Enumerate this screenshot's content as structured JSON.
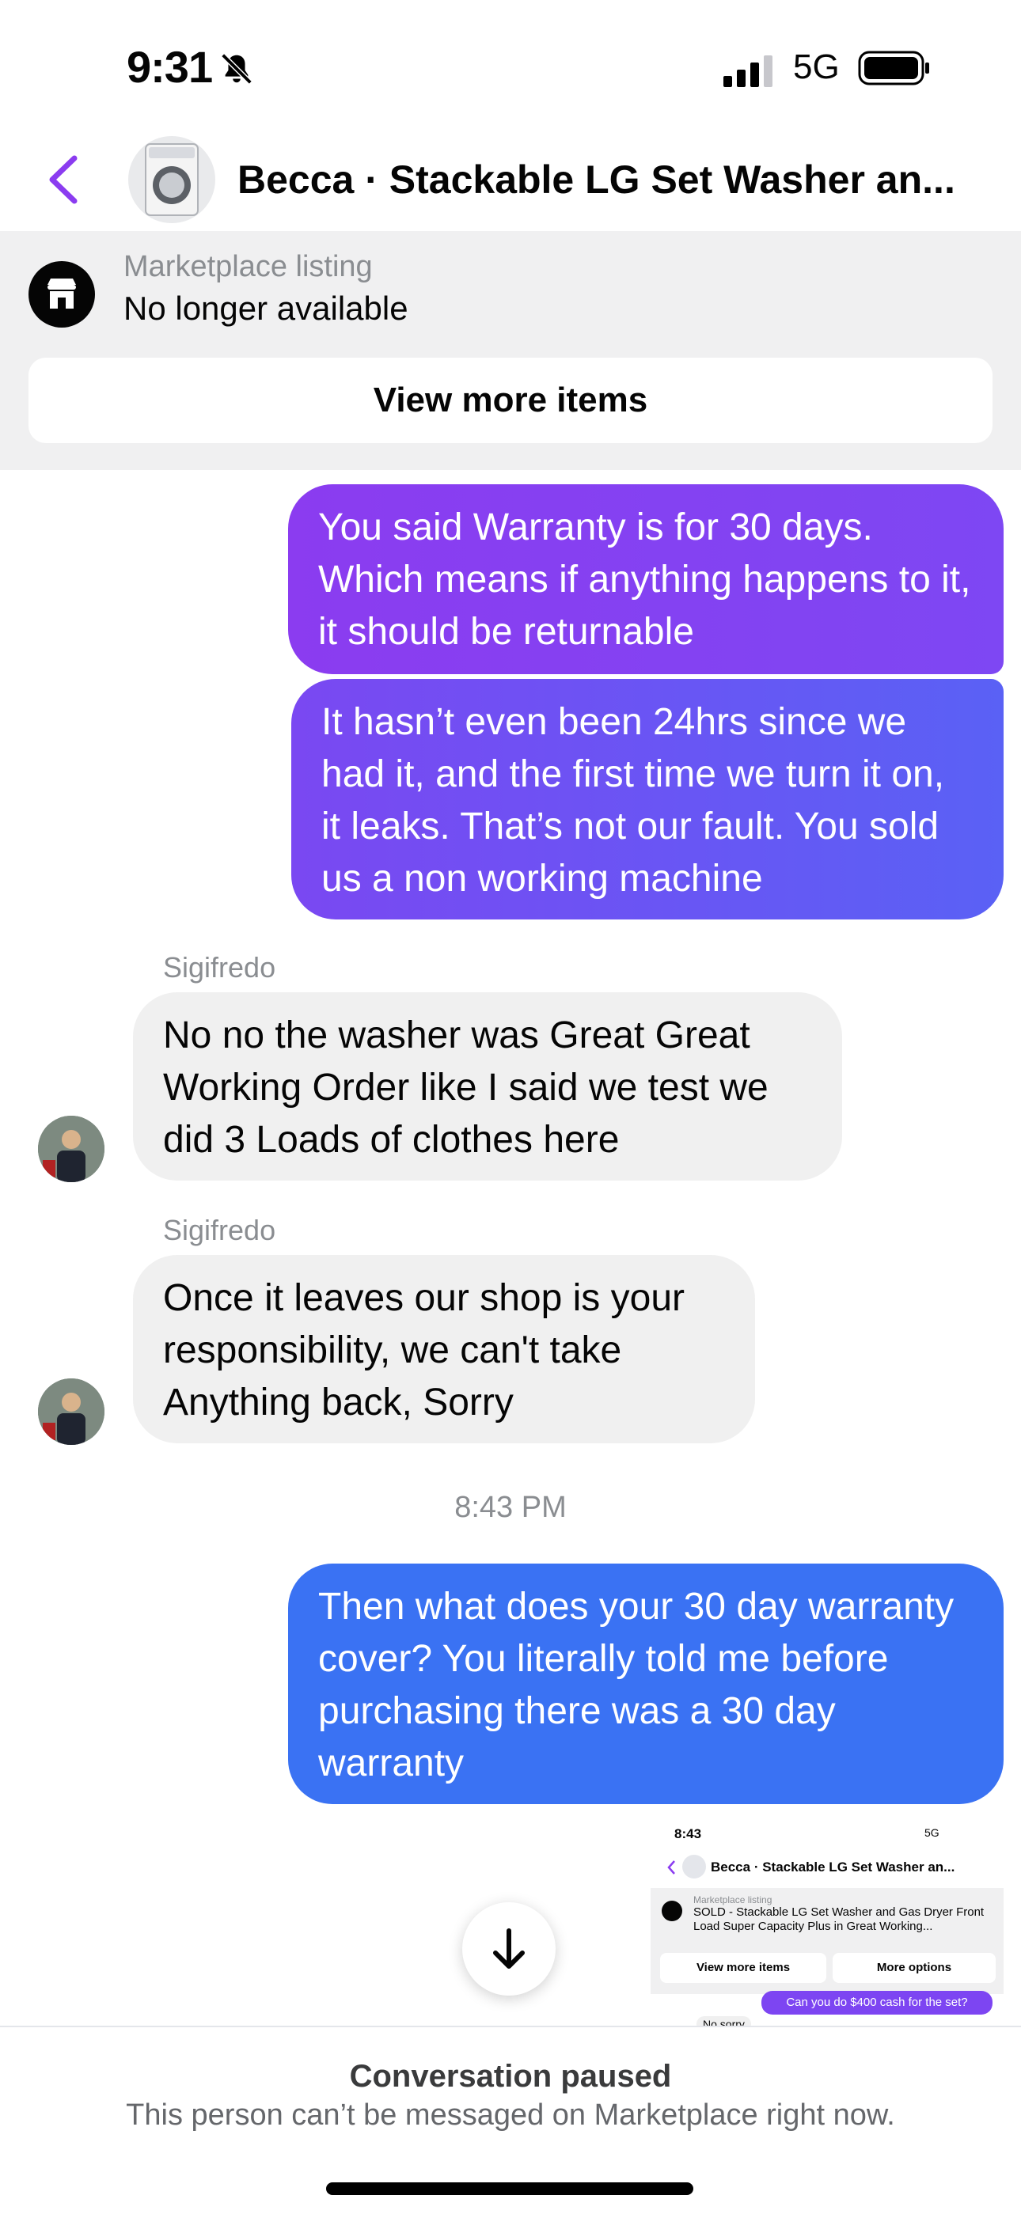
{
  "status_bar": {
    "time": "9:31",
    "network": "5G"
  },
  "header": {
    "title": "Becca · Stackable LG Set Washer an..."
  },
  "listing": {
    "label": "Marketplace listing",
    "status": "No longer available",
    "view_more": "View more items"
  },
  "messages": [
    {
      "type": "outgoing",
      "text": "You said Warranty is for 30 days. Which means if anything happens to it, it should be returnable"
    },
    {
      "type": "outgoing",
      "text": "It hasn’t even been 24hrs since we had it, and the first time we turn it on, it leaks. That’s not our fault. You sold us a non working machine"
    },
    {
      "type": "incoming",
      "sender": "Sigifredo",
      "text": "No no the washer was Great Great Working Order like I said we test we did 3 Loads of clothes here"
    },
    {
      "type": "incoming",
      "sender": "Sigifredo",
      "text": "Once it leaves our shop is your responsibility, we can't take Anything back, Sorry"
    },
    {
      "type": "outgoing",
      "text": "Then what does your 30 day warranty cover? You literally told me before purchasing there was a 30 day warranty"
    }
  ],
  "timestamp": "8:43 PM",
  "attachment": {
    "time": "8:43",
    "network": "5G",
    "title": "Becca · Stackable LG Set Washer an...",
    "listing_label": "Marketplace listing",
    "listing_text": "SOLD - Stackable LG Set Washer and Gas Dryer Front Load Super Capacity Plus in Great Working...",
    "btn_view_more": "View more items",
    "btn_more_options": "More options",
    "message": "Can you do $400 cash for the set?",
    "reply": "No sorry"
  },
  "footer": {
    "title": "Conversation paused",
    "subtitle": "This person can’t be messaged on Marketplace right now."
  },
  "colors": {
    "accent": "#8b3cf0",
    "outgoing_blue": "#3a72f3",
    "incoming": "#f0f0f0"
  }
}
